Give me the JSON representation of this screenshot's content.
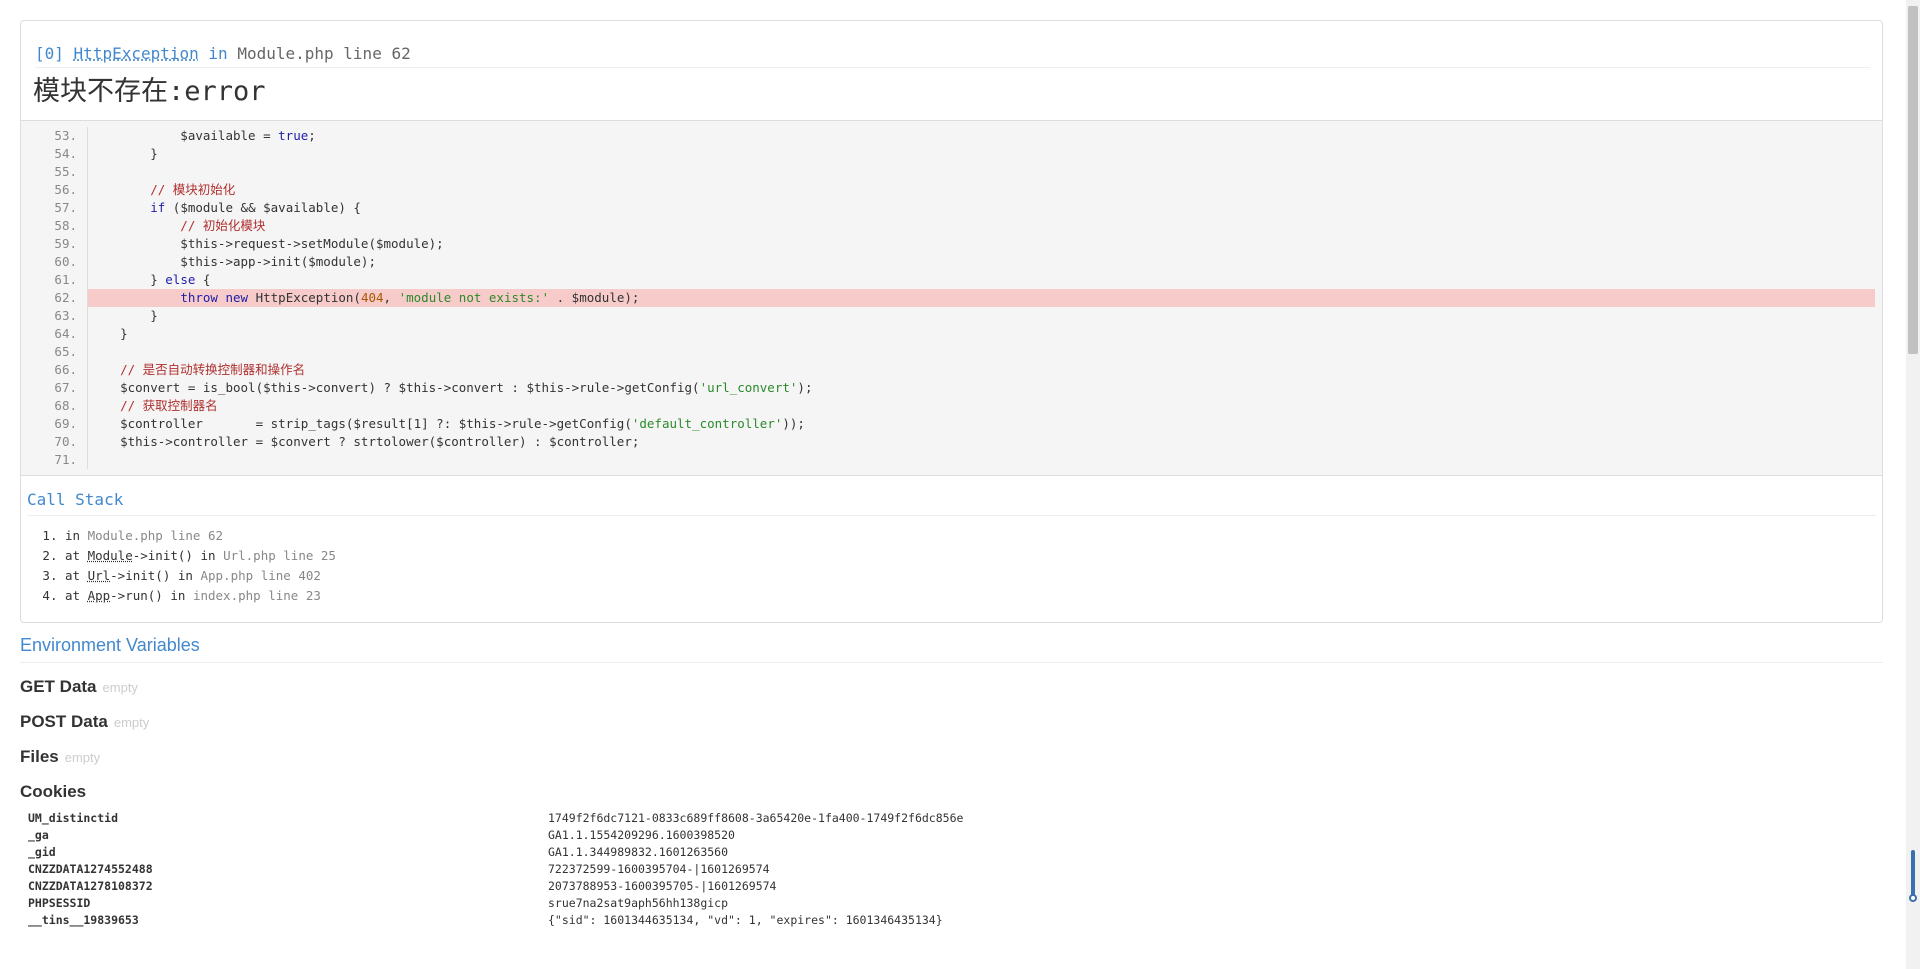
{
  "exception": {
    "index": "[0]",
    "class_name": "HttpException",
    "in_word": "in",
    "location": "Module.php line 62",
    "message": "模块不存在:error"
  },
  "source": {
    "lines": [
      {
        "n": "53.",
        "code": "            $available = true;",
        "hl": false
      },
      {
        "n": "54.",
        "code": "        }",
        "hl": false
      },
      {
        "n": "55.",
        "code": "",
        "hl": false
      },
      {
        "n": "56.",
        "code": "        // 模块初始化",
        "hl": false
      },
      {
        "n": "57.",
        "code": "        if ($module && $available) {",
        "hl": false
      },
      {
        "n": "58.",
        "code": "            // 初始化模块",
        "hl": false
      },
      {
        "n": "59.",
        "code": "            $this->request->setModule($module);",
        "hl": false
      },
      {
        "n": "60.",
        "code": "            $this->app->init($module);",
        "hl": false
      },
      {
        "n": "61.",
        "code": "        } else {",
        "hl": false
      },
      {
        "n": "62.",
        "code": "            throw new HttpException(404, 'module not exists:' . $module);",
        "hl": true
      },
      {
        "n": "63.",
        "code": "        }",
        "hl": false
      },
      {
        "n": "64.",
        "code": "    }",
        "hl": false
      },
      {
        "n": "65.",
        "code": "",
        "hl": false
      },
      {
        "n": "66.",
        "code": "    // 是否自动转换控制器和操作名",
        "hl": false
      },
      {
        "n": "67.",
        "code": "    $convert = is_bool($this->convert) ? $this->convert : $this->rule->getConfig('url_convert');",
        "hl": false
      },
      {
        "n": "68.",
        "code": "    // 获取控制器名",
        "hl": false
      },
      {
        "n": "69.",
        "code": "    $controller       = strip_tags($result[1] ?: $this->rule->getConfig('default_controller'));",
        "hl": false
      },
      {
        "n": "70.",
        "code": "    $this->controller = $convert ? strtolower($controller) : $controller;",
        "hl": false
      },
      {
        "n": "71.",
        "code": "",
        "hl": false
      }
    ]
  },
  "call_stack": {
    "title": "Call Stack",
    "items": [
      {
        "prefix": "in ",
        "call_class": "",
        "call_rest": "",
        "mid": "",
        "loc": "Module.php line 62"
      },
      {
        "prefix": "at ",
        "call_class": "Module",
        "call_rest": "->init()",
        "mid": " in ",
        "loc": "Url.php line 25"
      },
      {
        "prefix": "at ",
        "call_class": "Url",
        "call_rest": "->init()",
        "mid": " in ",
        "loc": "App.php line 402"
      },
      {
        "prefix": "at ",
        "call_class": "App",
        "call_rest": "->run()",
        "mid": " in ",
        "loc": "index.php line 23"
      }
    ]
  },
  "env": {
    "title": "Environment Variables",
    "get_label": "GET Data",
    "post_label": "POST Data",
    "files_label": "Files",
    "empty_label": "empty",
    "cookies_label": "Cookies",
    "cookies": [
      {
        "k": "UM_distinctid",
        "v": "1749f2f6dc7121-0833c689ff8608-3a65420e-1fa400-1749f2f6dc856e"
      },
      {
        "k": "_ga",
        "v": "GA1.1.1554209296.1600398520"
      },
      {
        "k": "_gid",
        "v": "GA1.1.344989832.1601263560"
      },
      {
        "k": "CNZZDATA1274552488",
        "v": "722372599-1600395704-|1601269574"
      },
      {
        "k": "CNZZDATA1278108372",
        "v": "2073788953-1600395705-|1601269574"
      },
      {
        "k": "PHPSESSID",
        "v": "srue7na2sat9aph56hh138gicp"
      },
      {
        "k": "__tins__19839653",
        "v": "{\"sid\": 1601344635134, \"vd\": 1, \"expires\": 1601346435134}"
      }
    ]
  },
  "colors": {
    "accent": "#4288ce",
    "highlight_line": "#f8cbcb",
    "code_bg": "#f5f5f5"
  }
}
